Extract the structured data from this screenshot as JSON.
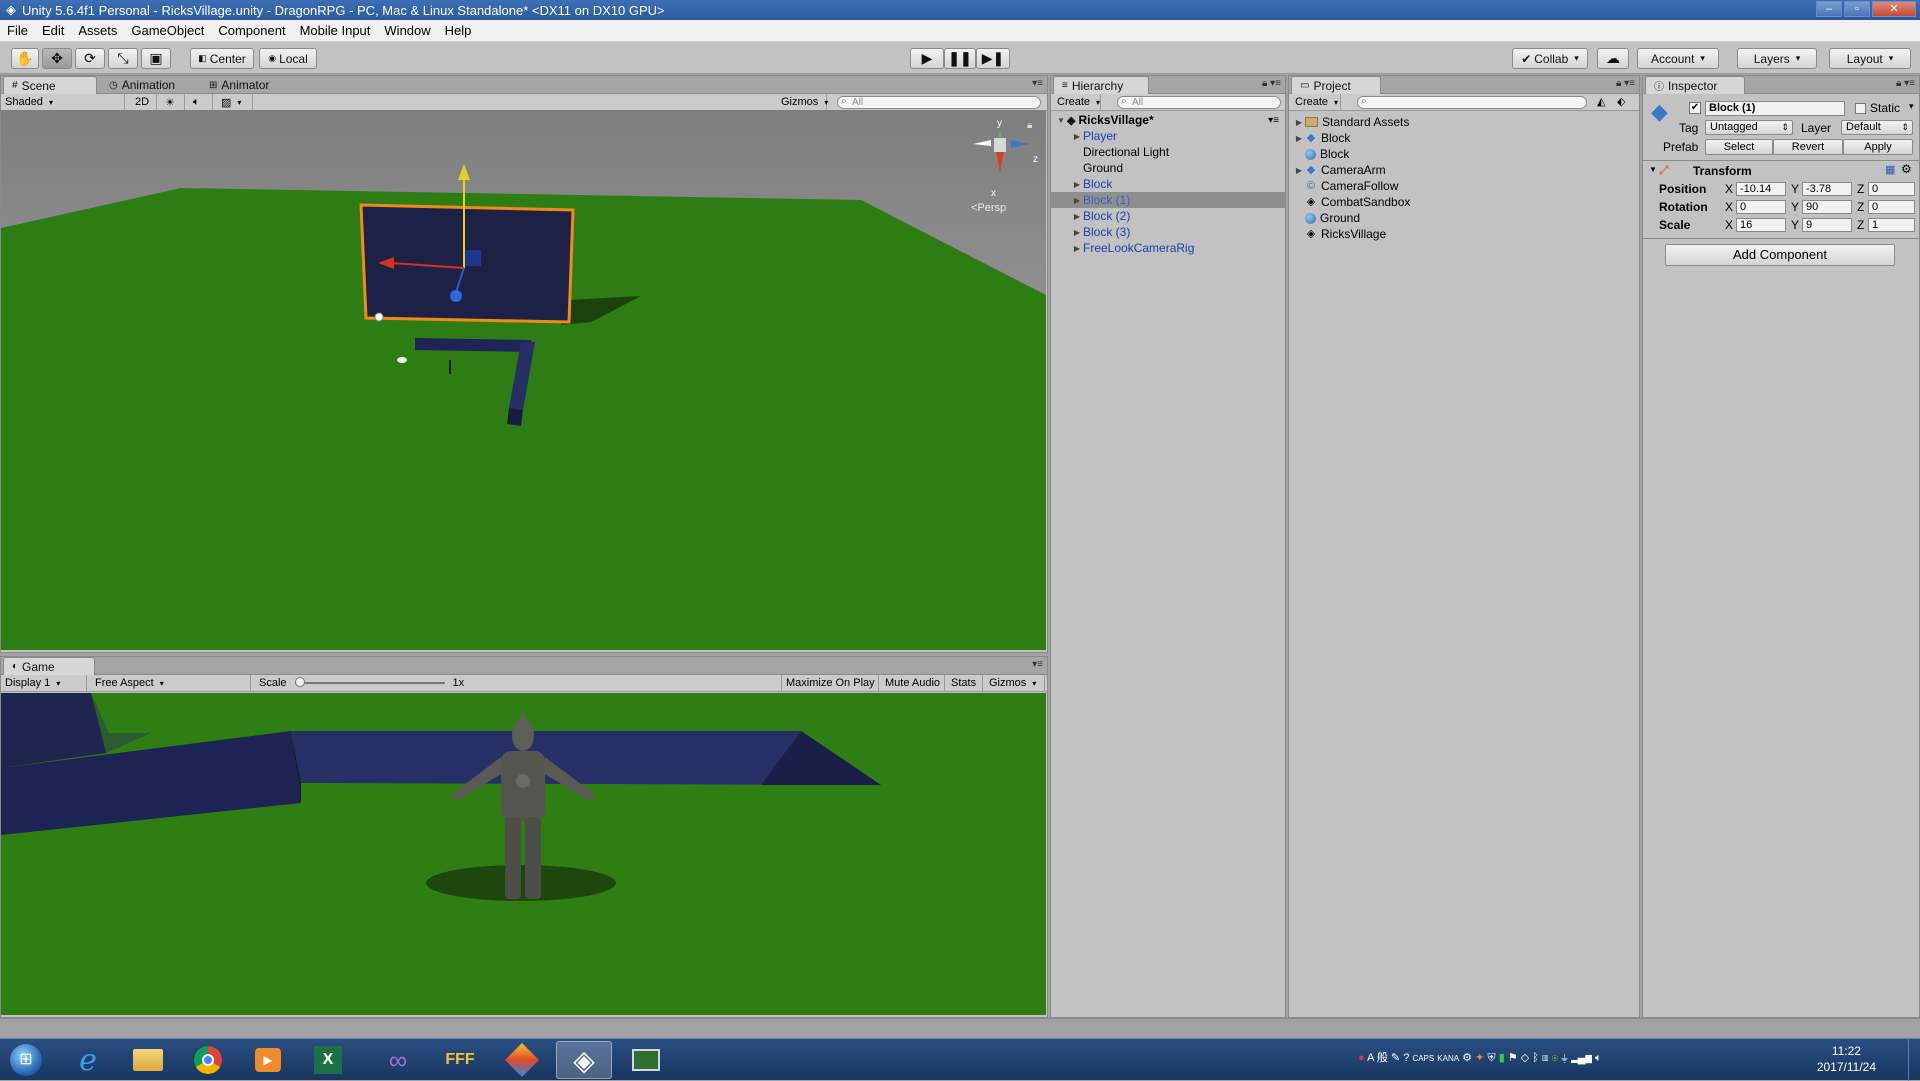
{
  "window": {
    "title": "Unity 5.6.4f1 Personal - RicksVillage.unity - DragonRPG - PC, Mac & Linux Standalone* <DX11 on DX10 GPU>",
    "controls": [
      "–",
      "▫",
      "✕"
    ]
  },
  "menu": [
    "File",
    "Edit",
    "Assets",
    "GameObject",
    "Component",
    "Mobile Input",
    "Window",
    "Help"
  ],
  "toolbar": {
    "tools": [
      "hand-icon",
      "move-icon",
      "rotate-icon",
      "scale-icon",
      "rect-icon"
    ],
    "pivot_label": "Center",
    "space_label": "Local",
    "collab_label": "Collab",
    "account_label": "Account",
    "layers_label": "Layers",
    "layout_label": "Layout"
  },
  "scene_panel": {
    "tabs": [
      "Scene",
      "Animation",
      "Animator"
    ],
    "shading": "Shaded",
    "mode_2d": "2D",
    "gizmos": "Gizmos",
    "search_placeholder": "All",
    "persp_label": "<Persp",
    "axis": {
      "y": "y",
      "z": "z",
      "x": "x"
    }
  },
  "game_panel": {
    "tab": "Game",
    "display": "Display 1",
    "aspect": "Free Aspect",
    "scale_label": "Scale",
    "scale_value": "1x",
    "maximize": "Maximize On Play",
    "mute": "Mute Audio",
    "stats": "Stats",
    "gizmos": "Gizmos"
  },
  "hierarchy": {
    "tab": "Hierarchy",
    "create": "Create",
    "search_placeholder": "All",
    "scene_name": "RicksVillage*",
    "items": [
      {
        "label": "Player",
        "prefab": true,
        "expandable": true,
        "selected": false
      },
      {
        "label": "Directional Light",
        "prefab": false,
        "expandable": false,
        "selected": false
      },
      {
        "label": "Ground",
        "prefab": false,
        "expandable": false,
        "selected": false
      },
      {
        "label": "Block",
        "prefab": true,
        "expandable": true,
        "selected": false
      },
      {
        "label": "Block (1)",
        "prefab": true,
        "expandable": true,
        "selected": true
      },
      {
        "label": "Block (2)",
        "prefab": true,
        "expandable": true,
        "selected": false
      },
      {
        "label": "Block (3)",
        "prefab": true,
        "expandable": true,
        "selected": false
      },
      {
        "label": "FreeLookCameraRig",
        "prefab": true,
        "expandable": true,
        "selected": false
      }
    ]
  },
  "project": {
    "tab": "Project",
    "create": "Create",
    "items": [
      {
        "label": "Standard Assets",
        "icon": "folder-icon",
        "expandable": true
      },
      {
        "label": "Block",
        "icon": "prefab-cube-icon",
        "expandable": true
      },
      {
        "label": "Block",
        "icon": "material-sphere-icon",
        "expandable": false
      },
      {
        "label": "CameraArm",
        "icon": "prefab-cube-icon",
        "expandable": true
      },
      {
        "label": "CameraFollow",
        "icon": "script-icon",
        "expandable": false
      },
      {
        "label": "CombatSandbox",
        "icon": "unity-scene-icon",
        "expandable": false
      },
      {
        "label": "Ground",
        "icon": "material-sphere-icon",
        "expandable": false
      },
      {
        "label": "RicksVillage",
        "icon": "unity-scene-icon",
        "expandable": false
      }
    ]
  },
  "inspector": {
    "tab": "Inspector",
    "object_name": "Block (1)",
    "static_label": "Static",
    "tag_label": "Tag",
    "tag_value": "Untagged",
    "layer_label": "Layer",
    "layer_value": "Default",
    "prefab_label": "Prefab",
    "prefab_buttons": [
      "Select",
      "Revert",
      "Apply"
    ],
    "transform_label": "Transform",
    "position": {
      "label": "Position",
      "x": "-10.14",
      "y": "-3.78",
      "z": "0"
    },
    "rotation": {
      "label": "Rotation",
      "x": "0",
      "y": "90",
      "z": "0"
    },
    "scale": {
      "label": "Scale",
      "x": "16",
      "y": "9",
      "z": "1"
    },
    "add_component": "Add Component"
  },
  "taskbar": {
    "apps": [
      "windows-start-icon",
      "internet-explorer-icon",
      "file-explorer-icon",
      "chrome-icon",
      "media-player-icon",
      "excel-icon",
      "visual-studio-icon",
      "app-icon",
      "paint-icon",
      "unity-icon",
      "monitor-icon"
    ],
    "tray_text": [
      "A",
      "般",
      "CAPS",
      "KANA"
    ],
    "time": "11:22",
    "date": "2017/11/24"
  }
}
